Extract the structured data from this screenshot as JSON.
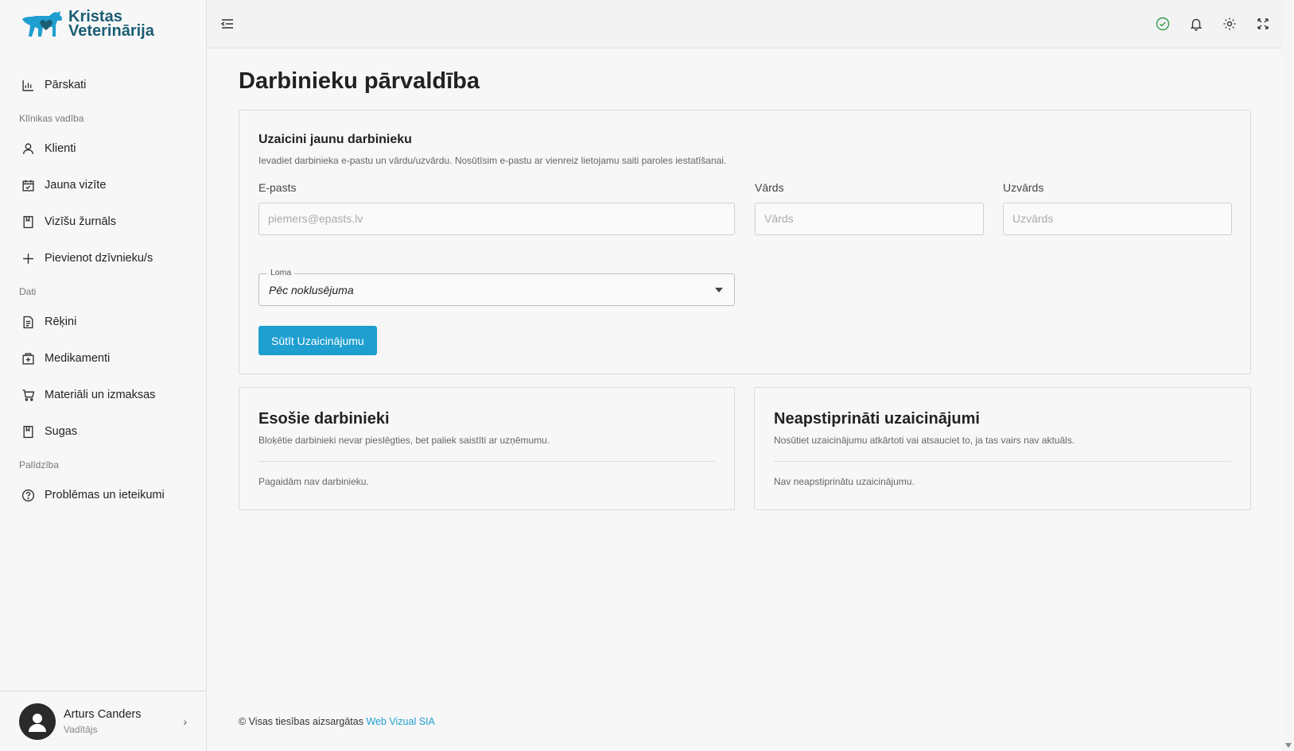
{
  "brand": {
    "line1": "Kristas",
    "line2": "Veterinārija",
    "color": "#1b5e74"
  },
  "sidebar": {
    "items": [
      {
        "label": "Pārskati",
        "icon": "bar-chart-icon"
      },
      {
        "section": "Klīnikas vadība"
      },
      {
        "label": "Klienti",
        "icon": "user-icon"
      },
      {
        "label": "Jauna vizīte",
        "icon": "calendar-icon"
      },
      {
        "label": "Vizīšu žurnāls",
        "icon": "book-icon"
      },
      {
        "label": "Pievienot dzīvnieku/s",
        "icon": "plus-icon"
      },
      {
        "section": "Dati"
      },
      {
        "label": "Rēķini",
        "icon": "invoice-icon"
      },
      {
        "label": "Medikamenti",
        "icon": "medicine-icon"
      },
      {
        "label": "Materiāli un izmaksas",
        "icon": "cart-icon"
      },
      {
        "label": "Sugas",
        "icon": "book-icon"
      },
      {
        "section": "Palīdzība"
      },
      {
        "label": "Problēmas un ieteikumi",
        "icon": "help-icon"
      }
    ],
    "profile": {
      "name": "Arturs Canders",
      "role": "Vadītājs"
    }
  },
  "page": {
    "title": "Darbinieku pārvaldība"
  },
  "invite": {
    "title": "Uzaicini jaunu darbinieku",
    "description": "Ievadiet darbinieka e-pastu un vārdu/uzvārdu. Nosūtīsim e-pastu ar vienreiz lietojamu saiti paroles iestatīšanai.",
    "email_label": "E-pasts",
    "email_placeholder": "piemers@epasts.lv",
    "first_name_label": "Vārds",
    "first_name_placeholder": "Vārds",
    "last_name_label": "Uzvārds",
    "last_name_placeholder": "Uzvārds",
    "role_label": "Loma",
    "role_value": "Pēc noklusējuma",
    "submit_label": "Sūtīt Uzaicinājumu",
    "accent": "#1e9fd0"
  },
  "employees": {
    "title": "Esošie darbinieki",
    "description": "Bloķētie darbinieki nevar pieslēgties, bet paliek saistīti ar uzņēmumu.",
    "empty": "Pagaidām nav darbinieku."
  },
  "pending": {
    "title": "Neapstiprināti uzaicinājumi",
    "description": "Nosūtiet uzaicinājumu atkārtoti vai atsauciet to, ja tas vairs nav aktuāls.",
    "empty": "Nav neapstiprinātu uzaicinājumu."
  },
  "footer": {
    "text": "© Visas tiesības aizsargātas",
    "link": "Web Vizual SIA"
  },
  "status_color": "#2e9e4f"
}
